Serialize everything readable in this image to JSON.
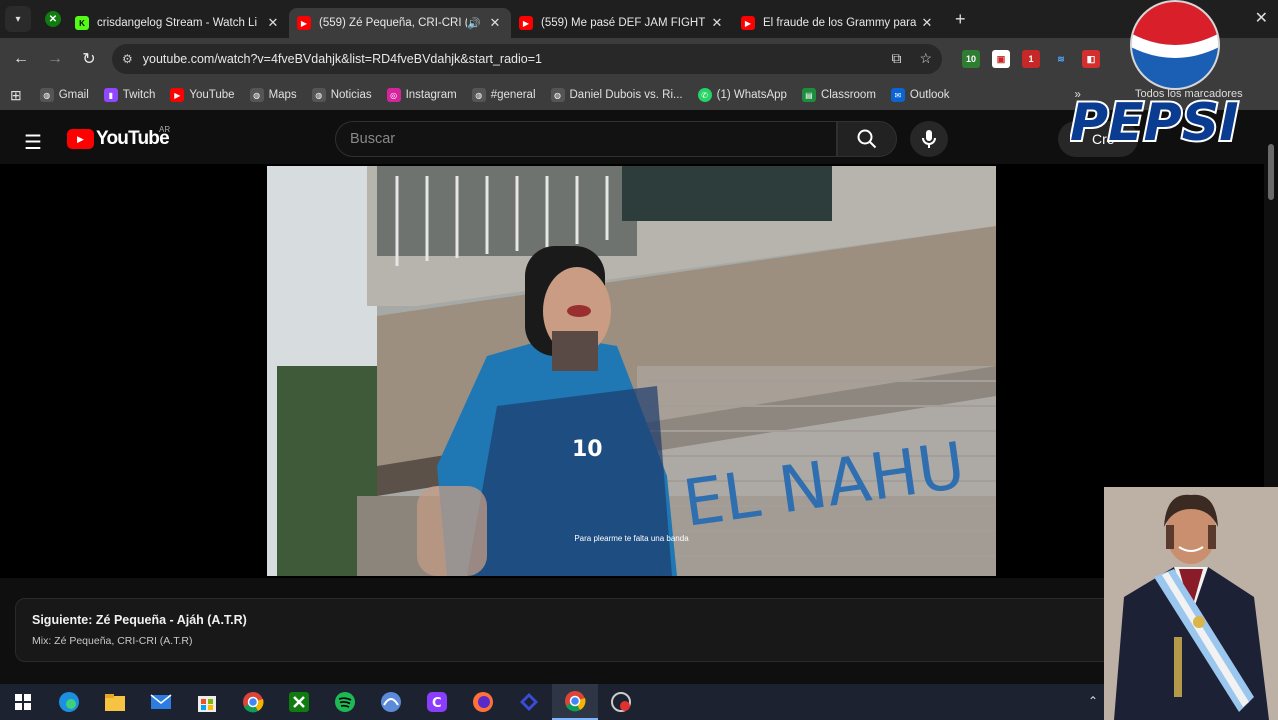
{
  "browser": {
    "tabs": [
      {
        "title": "crisdangelog Stream - Watch Li",
        "active": false
      },
      {
        "title": "(559) Zé Pequeña, CRI-CRI (",
        "active": true
      },
      {
        "title": "(559) Me pasé DEF JAM FIGHT",
        "active": false
      },
      {
        "title": "El fraude de los Grammy para v",
        "active": false
      }
    ],
    "url": "youtube.com/watch?v=4fveBVdahjk&list=RD4fveBVdahjk&start_radio=1",
    "bookmarks": [
      "Gmail",
      "Twitch",
      "YouTube",
      "Maps",
      "Noticias",
      "Instagram",
      "#general",
      "Daniel Dubois vs. Ri...",
      "(1) WhatsApp",
      "Classroom",
      "Outlook"
    ],
    "bookmarks_overflow": "»",
    "all_bookmarks": "Todos los marcadores",
    "ext_badges": [
      "10",
      "1"
    ]
  },
  "youtube": {
    "logo_text": "YouTube",
    "country": "AR",
    "search_placeholder": "Buscar",
    "create_label": "Cre"
  },
  "video": {
    "subtitle": "Para plearme te falta una banda",
    "jersey_number": "10",
    "graffiti": "EL NAHU"
  },
  "up_next": {
    "title": "Siguiente: Zé Pequeña - Ajáh (A.T.R)",
    "subtitle": "Mix: Zé Pequeña, CRI-CRI (A.T.R)"
  },
  "overlay": {
    "brand": "PEPSI"
  },
  "colors": {
    "youtube_red": "#ff0000",
    "pepsi_blue": "#0a3d91"
  }
}
